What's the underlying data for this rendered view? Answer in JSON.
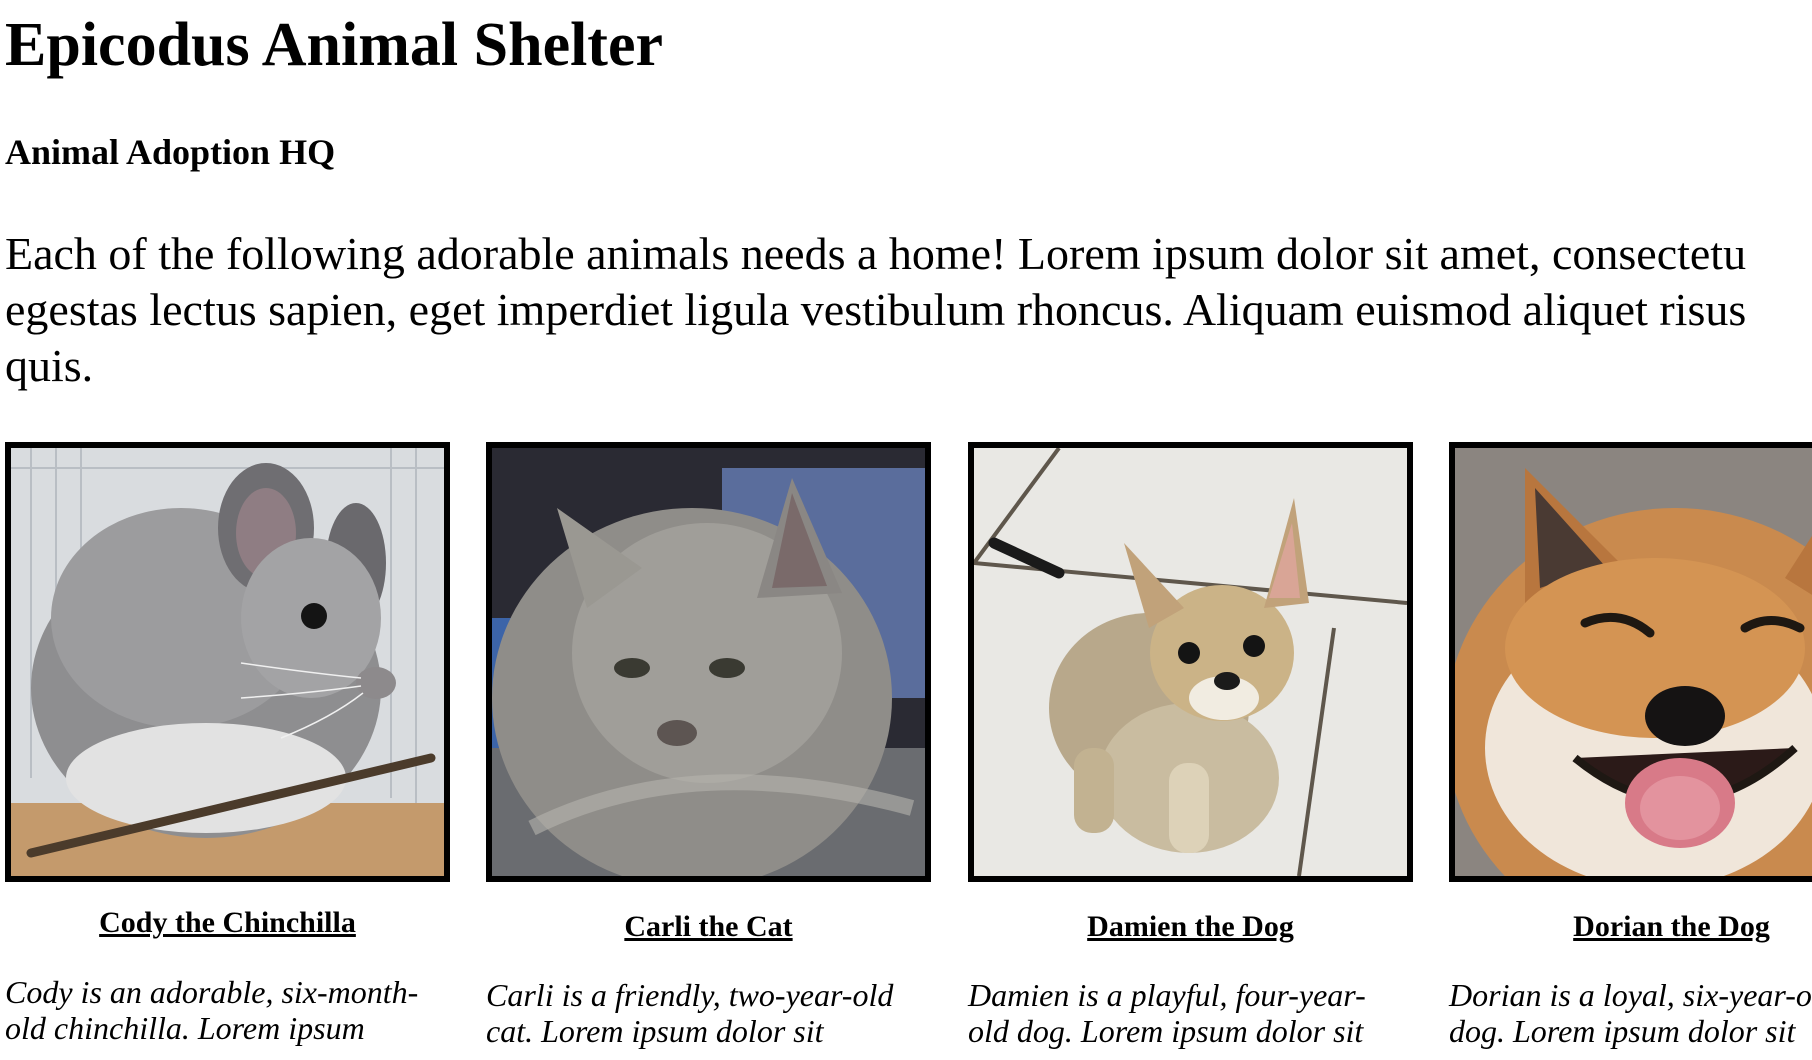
{
  "header": {
    "title": "Epicodus Animal Shelter",
    "subtitle": "Animal Adoption HQ"
  },
  "intro": {
    "lines": [
      "Each of the following adorable animals needs a home! Lorem ipsum dolor sit amet, consectetu",
      "egestas lectus sapien, eget imperdiet ligula vestibulum rhoncus. Aliquam euismod aliquet risus",
      "quis."
    ]
  },
  "animals": [
    {
      "name": "Cody the Chinchilla",
      "desc_line1": "Cody is an adorable, six-month-",
      "desc_line2": "old chinchilla. Lorem ipsum",
      "photo": "chinchilla-photo"
    },
    {
      "name": "Carli the Cat",
      "desc_line1": "Carli is a friendly, two-year-old",
      "desc_line2": "cat. Lorem ipsum dolor sit",
      "photo": "cat-photo"
    },
    {
      "name": "Damien the Dog",
      "desc_line1": "Damien is a playful, four-year-",
      "desc_line2": "old dog. Lorem ipsum dolor sit",
      "photo": "dog-photo"
    },
    {
      "name": "Dorian the Dog",
      "desc_line1": "Dorian is a loyal, six-year-o",
      "desc_line2": "dog. Lorem ipsum dolor sit",
      "photo": "dog-photo"
    }
  ],
  "colors": {
    "text": "#000000",
    "background": "#ffffff",
    "photo_border": "#000000"
  }
}
